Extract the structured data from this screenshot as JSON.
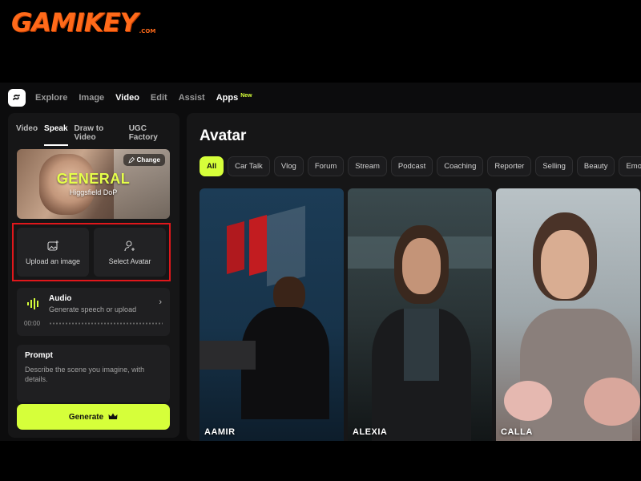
{
  "watermark": {
    "brand": "GAMIKEY",
    "suffix": ".COM"
  },
  "topnav": {
    "items": [
      {
        "label": "Explore",
        "active": false
      },
      {
        "label": "Image",
        "active": false
      },
      {
        "label": "Video",
        "active": true
      },
      {
        "label": "Edit",
        "active": false
      },
      {
        "label": "Assist",
        "active": false
      },
      {
        "label": "Apps",
        "active": false,
        "badge": "New"
      }
    ]
  },
  "left": {
    "subtabs": [
      {
        "label": "Video",
        "active": false
      },
      {
        "label": "Speak",
        "active": true
      },
      {
        "label": "Draw to Video",
        "active": false
      },
      {
        "label": "UGC Factory",
        "active": false
      }
    ],
    "hero": {
      "title": "GENERAL",
      "subtitle": "Higgsfield DoP",
      "change_label": "Change"
    },
    "upload_image_label": "Upload an image",
    "select_avatar_label": "Select Avatar",
    "audio": {
      "title": "Audio",
      "subtitle": "Generate speech or upload",
      "time": "00:00"
    },
    "prompt": {
      "title": "Prompt",
      "placeholder": "Describe the scene you imagine, with details."
    },
    "generate_label": "Generate"
  },
  "right": {
    "title": "Avatar",
    "chips": [
      {
        "label": "All",
        "active": true
      },
      {
        "label": "Car Talk",
        "active": false
      },
      {
        "label": "Vlog",
        "active": false
      },
      {
        "label": "Forum",
        "active": false
      },
      {
        "label": "Stream",
        "active": false
      },
      {
        "label": "Podcast",
        "active": false
      },
      {
        "label": "Coaching",
        "active": false
      },
      {
        "label": "Reporter",
        "active": false
      },
      {
        "label": "Selling",
        "active": false
      },
      {
        "label": "Beauty",
        "active": false
      },
      {
        "label": "Emotions",
        "active": false
      }
    ],
    "avatars": [
      {
        "name": "AAMIR"
      },
      {
        "name": "ALEXIA"
      },
      {
        "name": "CALLA"
      }
    ]
  },
  "colors": {
    "accent": "#d6ff3a",
    "highlight_border": "#e0171b",
    "panel": "#161617"
  }
}
